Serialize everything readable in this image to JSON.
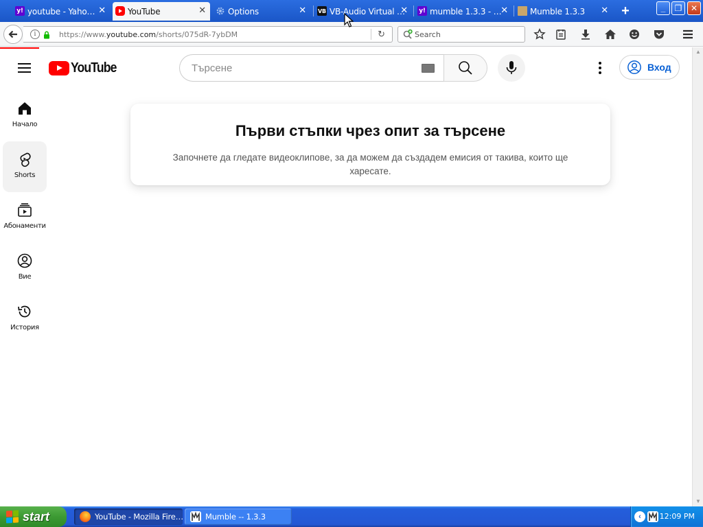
{
  "browser": {
    "tabs": [
      {
        "label": "youtube - Yaho…",
        "favicon": "yahoo-icon",
        "active": false
      },
      {
        "label": "YouTube",
        "favicon": "youtube-icon",
        "active": true
      },
      {
        "label": "Options",
        "favicon": "gear-icon",
        "active": false
      },
      {
        "label": "VB-Audio Virtual …",
        "favicon": "vb-audio-icon",
        "active": false
      },
      {
        "label": "mumble 1.3.3 - …",
        "favicon": "yahoo-icon",
        "active": false
      },
      {
        "label": "Mumble 1.3.3",
        "favicon": "mumble-package-icon",
        "active": false
      }
    ],
    "url_prefix": "https://www.",
    "url_host": "youtube.com",
    "url_path": "/shorts/075dR-7ybDM",
    "search_placeholder": "Search",
    "colors": {
      "titlebar": "#1a56c7",
      "active_tab": "#f5f6f7"
    }
  },
  "youtube": {
    "logo_text": "YouTube",
    "search_placeholder": "Търсене",
    "sign_in_label": "Вход",
    "guide": [
      {
        "label": "Начало",
        "icon": "home-icon",
        "active": false
      },
      {
        "label": "Shorts",
        "icon": "shorts-icon",
        "active": true
      },
      {
        "label": "Абонаменти",
        "icon": "subscriptions-icon",
        "active": false
      },
      {
        "label": "Вие",
        "icon": "account-icon",
        "active": false
      },
      {
        "label": "История",
        "icon": "history-icon",
        "active": false
      }
    ],
    "promo": {
      "title": "Първи стъпки чрез опит за търсене",
      "body": "Започнете да гледате видеоклипове, за да можем да създадем емисия от такива, които ще харесате."
    },
    "colors": {
      "brand_red": "#ff0000",
      "link_blue": "#065fd4"
    }
  },
  "taskbar": {
    "start_label": "start",
    "tasks": [
      {
        "label": "YouTube - Mozilla Fire…",
        "icon": "firefox-icon",
        "pressed": true
      },
      {
        "label": "Mumble -- 1.3.3",
        "icon": "mumble-icon",
        "pressed": false
      }
    ],
    "clock": "12:09 PM"
  }
}
